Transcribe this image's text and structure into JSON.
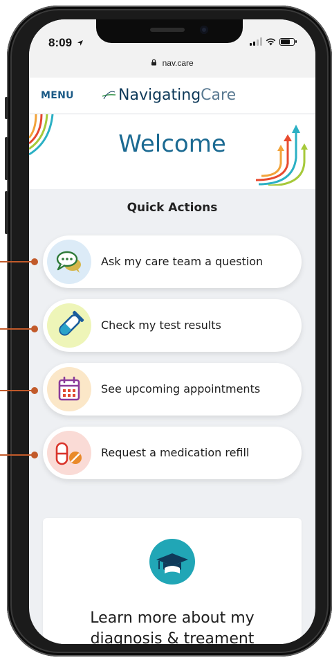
{
  "status_bar": {
    "time": "8:09",
    "location_icon": "location-arrow-icon",
    "signal_icon": "signal-icon",
    "wifi_icon": "wifi-icon",
    "battery_icon": "battery-icon"
  },
  "browser": {
    "url": "nav.care",
    "lock_icon": "lock-icon"
  },
  "app_bar": {
    "menu_label": "MENU",
    "brand_part1": "Navigating",
    "brand_part2": "Care"
  },
  "hero": {
    "welcome": "Welcome"
  },
  "quick_actions": {
    "title": "Quick Actions",
    "items": [
      {
        "label": "Ask my care team a question",
        "icon": "chat-bubbles-icon",
        "icon_bg": "#dcebf7"
      },
      {
        "label": "Check my test results",
        "icon": "test-tube-icon",
        "icon_bg": "#eef5b8"
      },
      {
        "label": "See upcoming appointments",
        "icon": "calendar-icon",
        "icon_bg": "#fbe7c8"
      },
      {
        "label": "Request a medication refill",
        "icon": "pills-icon",
        "icon_bg": "#fadbd6"
      }
    ]
  },
  "learn_card": {
    "line1": "Learn more about my",
    "line2": "diagnosis & treament",
    "icon": "graduation-cap-icon"
  },
  "colors": {
    "brand_blue": "#1b6a92",
    "callout": "#c25a2a",
    "teal": "#21a6b6"
  }
}
